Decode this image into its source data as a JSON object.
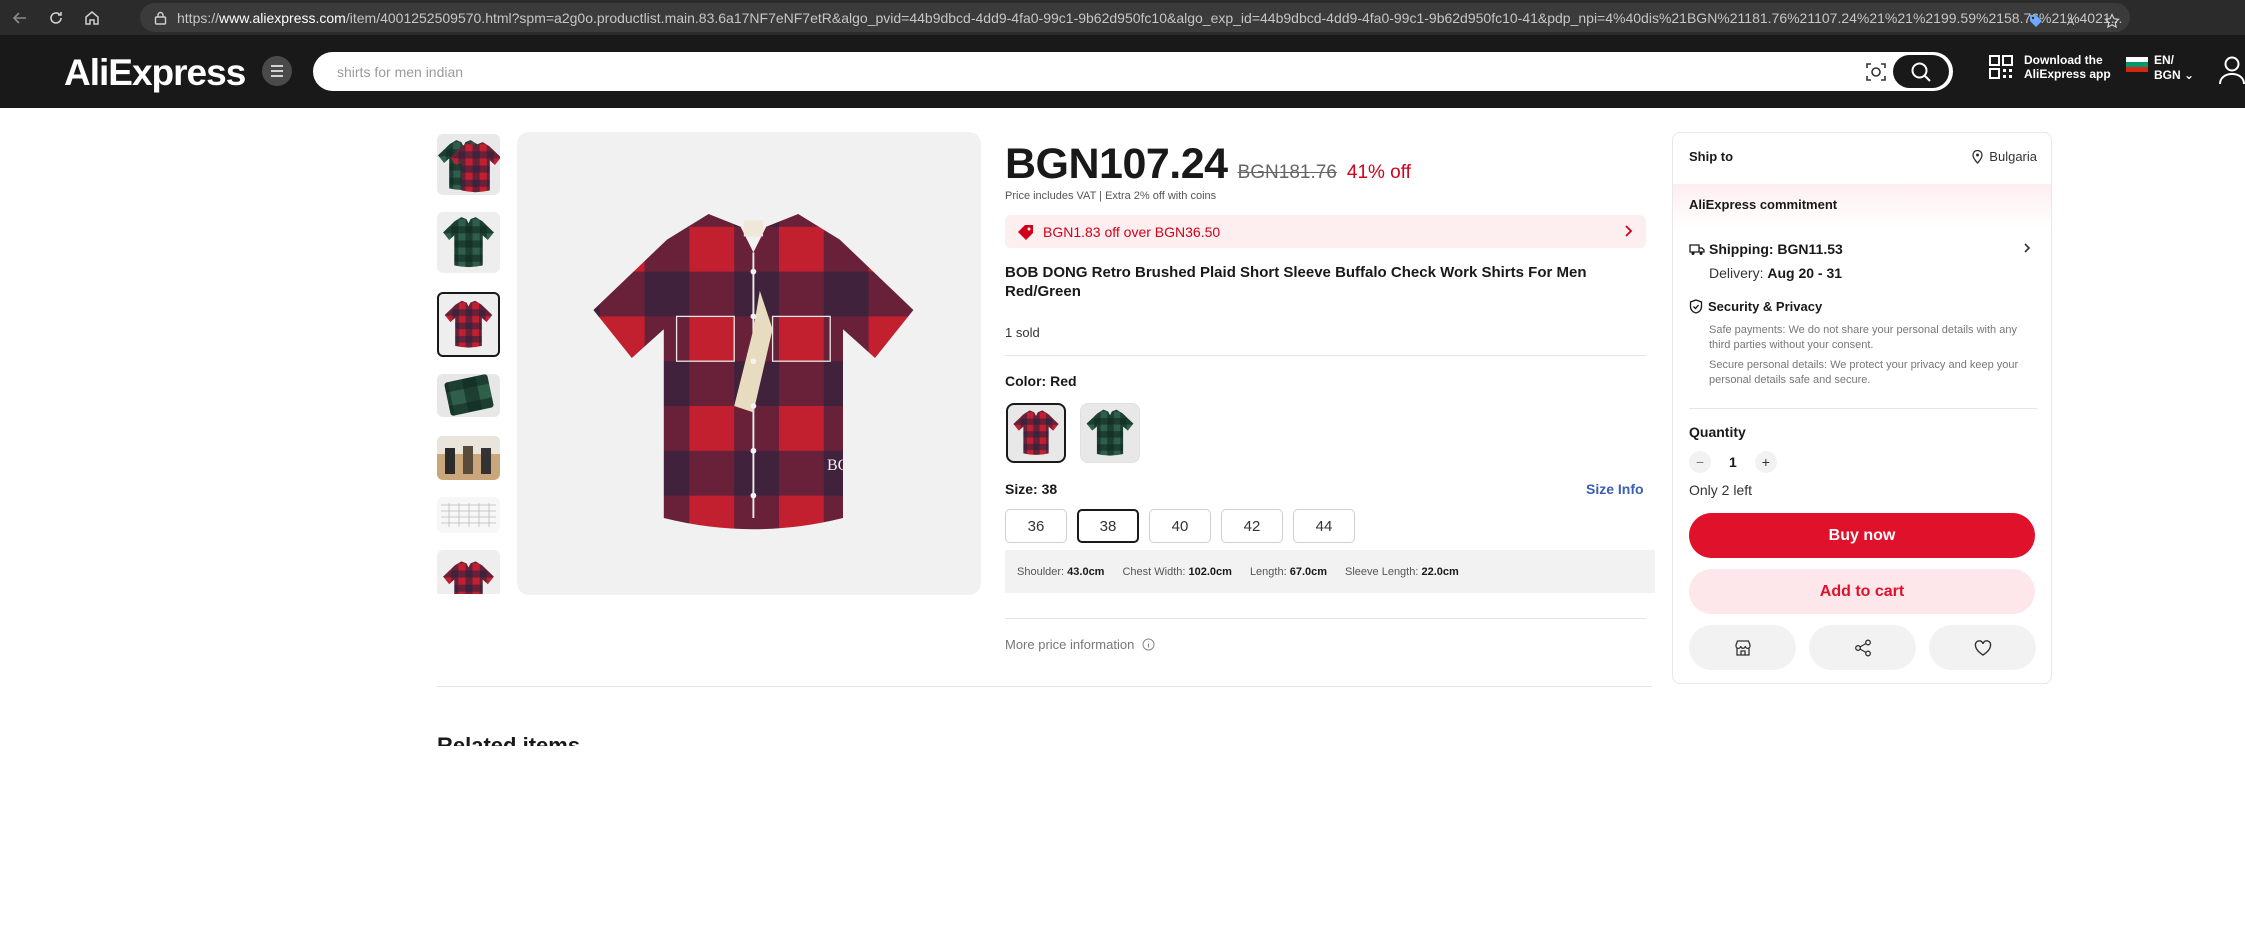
{
  "browser": {
    "url_prefix": "https://",
    "url_domain": "www.aliexpress.com",
    "url_rest": "/item/4001252509570.html?spm=a2g0o.productlist.main.83.6a17NF7eNF7etR&algo_pvid=44b9dbcd-4dd9-4fa0-99c1-9b62d950fc10&algo_exp_id=44b9dbcd-4dd9-4fa0-99c1-9b62d950fc10-41&pdp_npi=4%40dis%21BGN%21181.76%21107.24%21%21%2199.59%2158.76%21%4021..."
  },
  "header": {
    "logo": "AliExpress",
    "search_placeholder": "shirts for men indian",
    "app_download": "Download the AliExpress app",
    "lang": "EN/",
    "currency": "BGN"
  },
  "product": {
    "price": "BGN107.24",
    "original_price": "BGN181.76",
    "discount": "41% off",
    "vat_note": "Price includes VAT  |  Extra 2% off with coins",
    "coupon": "BGN1.83 off over BGN36.50",
    "title": "BOB DONG Retro Brushed Plaid Short Sleeve Buffalo Check Work Shirts For Men Red/Green",
    "sold": "1 sold",
    "color_label": "Color: Red",
    "size_label": "Size: 38",
    "size_info": "Size Info",
    "sizes": [
      "36",
      "38",
      "40",
      "42",
      "44"
    ],
    "selected_size": "38",
    "measurements": {
      "shoulder_label": "Shoulder:",
      "shoulder": "43.0cm",
      "chest_label": "Chest Width:",
      "chest": "102.0cm",
      "length_label": "Length:",
      "length": "67.0cm",
      "sleeve_label": "Sleeve Length:",
      "sleeve": "22.0cm"
    },
    "more_price": "More price information",
    "image_watermark": "BOB DO"
  },
  "panel": {
    "ship_to": "Ship to",
    "destination": "Bulgaria",
    "commitment": "AliExpress commitment",
    "shipping": "Shipping: BGN11.53",
    "delivery_label": "Delivery:",
    "delivery_dates": "Aug 20 - 31",
    "security_title": "Security & Privacy",
    "security_text_1": "Safe payments: We do not share your personal details with any third parties without your consent.",
    "security_text_2": "Secure personal details: We protect your privacy and keep your personal details safe and secure.",
    "quantity_label": "Quantity",
    "quantity": "1",
    "stock": "Only 2 left",
    "buy_now": "Buy now",
    "add_to_cart": "Add to cart"
  },
  "related": {
    "title": "Related items"
  },
  "colors": {
    "red": "#e0112b",
    "dark": "#191919",
    "plaid_red": "#c2202f",
    "plaid_navy": "#1e2340",
    "plaid_green": "#1f4a3a",
    "link_blue": "#3a5fb0"
  }
}
